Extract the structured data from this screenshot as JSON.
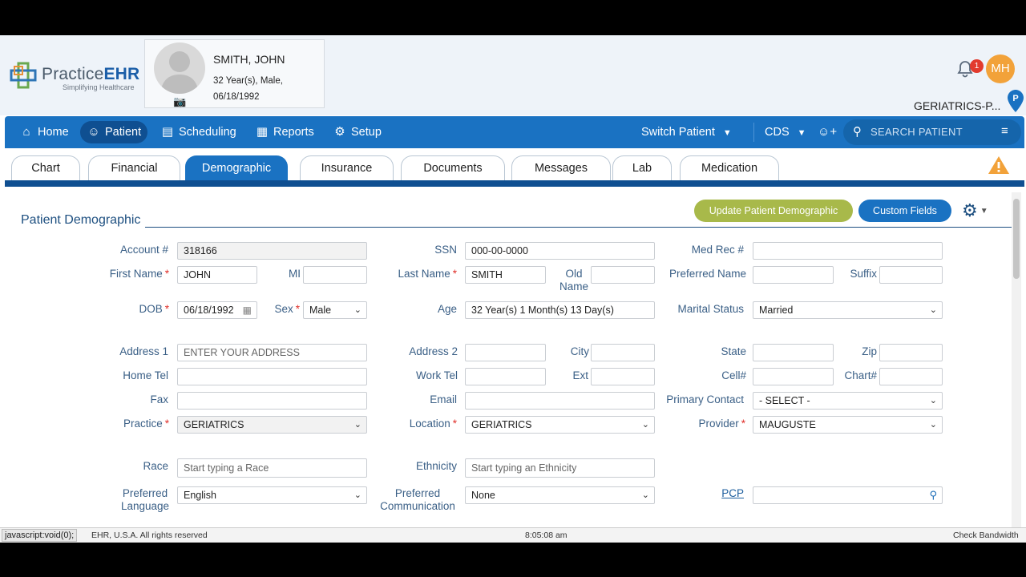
{
  "header": {
    "logo_name_part1": "Practice",
    "logo_name_part2": "EHR",
    "logo_tagline": "Simplifying Healthcare",
    "patient_name": "SMITH, JOHN",
    "patient_age_sex": "32 Year(s), Male,",
    "patient_dob": "06/18/1992",
    "notification_count": "1",
    "user_initials": "MH",
    "location_label": "GERIATRICS-P..."
  },
  "nav": {
    "items": [
      {
        "label": "Home",
        "icon": "home-icon"
      },
      {
        "label": "Patient",
        "icon": "user-icon"
      },
      {
        "label": "Scheduling",
        "icon": "calendar-clock-icon"
      },
      {
        "label": "Reports",
        "icon": "report-chart-icon"
      },
      {
        "label": "Setup",
        "icon": "setup-icon"
      }
    ],
    "switch_patient": "Switch Patient",
    "cds": "CDS",
    "search_placeholder": "SEARCH PATIENT"
  },
  "tabs": [
    {
      "label": "Chart"
    },
    {
      "label": "Financial"
    },
    {
      "label": "Demographic",
      "active": true
    },
    {
      "label": "Insurance"
    },
    {
      "label": "Documents"
    },
    {
      "label": "Messages"
    },
    {
      "label": "Lab"
    },
    {
      "label": "Medication"
    }
  ],
  "section": {
    "title": "Patient Demographic",
    "update_button": "Update Patient Demographic",
    "custom_fields_button": "Custom Fields"
  },
  "form": {
    "account_label": "Account #",
    "account_value": "318166",
    "ssn_label": "SSN",
    "ssn_value": "000-00-0000",
    "medrec_label": "Med Rec #",
    "medrec_value": "",
    "first_name_label": "First Name",
    "first_name_value": "JOHN",
    "mi_label": "MI",
    "mi_value": "",
    "last_name_label": "Last Name",
    "last_name_value": "SMITH",
    "old_name_label": "Old Name",
    "old_name_value": "",
    "preferred_name_label": "Preferred Name",
    "preferred_name_value": "",
    "suffix_label": "Suffix",
    "suffix_value": "",
    "dob_label": "DOB",
    "dob_value": "06/18/1992",
    "sex_label": "Sex",
    "sex_value": "Male",
    "age_label": "Age",
    "age_value": "32 Year(s) 1 Month(s) 13 Day(s)",
    "marital_label": "Marital Status",
    "marital_value": "Married",
    "address1_label": "Address 1",
    "address1_placeholder": "ENTER YOUR ADDRESS",
    "address2_label": "Address 2",
    "address2_value": "",
    "city_label": "City",
    "city_value": "",
    "state_label": "State",
    "state_value": "",
    "zip_label": "Zip",
    "zip_value": "",
    "home_tel_label": "Home Tel",
    "home_tel_value": "",
    "work_tel_label": "Work Tel",
    "work_tel_value": "",
    "ext_label": "Ext",
    "ext_value": "",
    "cell_label": "Cell#",
    "cell_value": "",
    "chart_label": "Chart#",
    "chart_value": "",
    "fax_label": "Fax",
    "fax_value": "",
    "email_label": "Email",
    "email_value": "",
    "primary_contact_label": "Primary Contact",
    "primary_contact_value": "- SELECT -",
    "practice_label": "Practice",
    "practice_value": "GERIATRICS",
    "location_label": "Location",
    "location_value": "GERIATRICS",
    "provider_label": "Provider",
    "provider_value": "MAUGUSTE",
    "race_label": "Race",
    "race_placeholder": "Start typing a Race",
    "ethnicity_label": "Ethnicity",
    "ethnicity_placeholder": "Start typing an Ethnicity",
    "pref_lang_label": "Preferred Language",
    "pref_lang_value": "English",
    "pref_comm_label": "Preferred Communication",
    "pref_comm_value": "None",
    "pcp_label": "PCP",
    "pcp_value": ""
  },
  "status_bar": {
    "link_text": "javascript:void(0);",
    "copyright": "EHR, U.S.A. All rights reserved",
    "time": "8:05:08 am",
    "bandwidth": "Check Bandwidth"
  },
  "colors": {
    "nav_blue": "#1a72c2",
    "nav_dark": "#0f4f91",
    "update_green": "#a8b94a",
    "required_red": "#e0302a",
    "avatar_orange": "#f2a23a"
  }
}
